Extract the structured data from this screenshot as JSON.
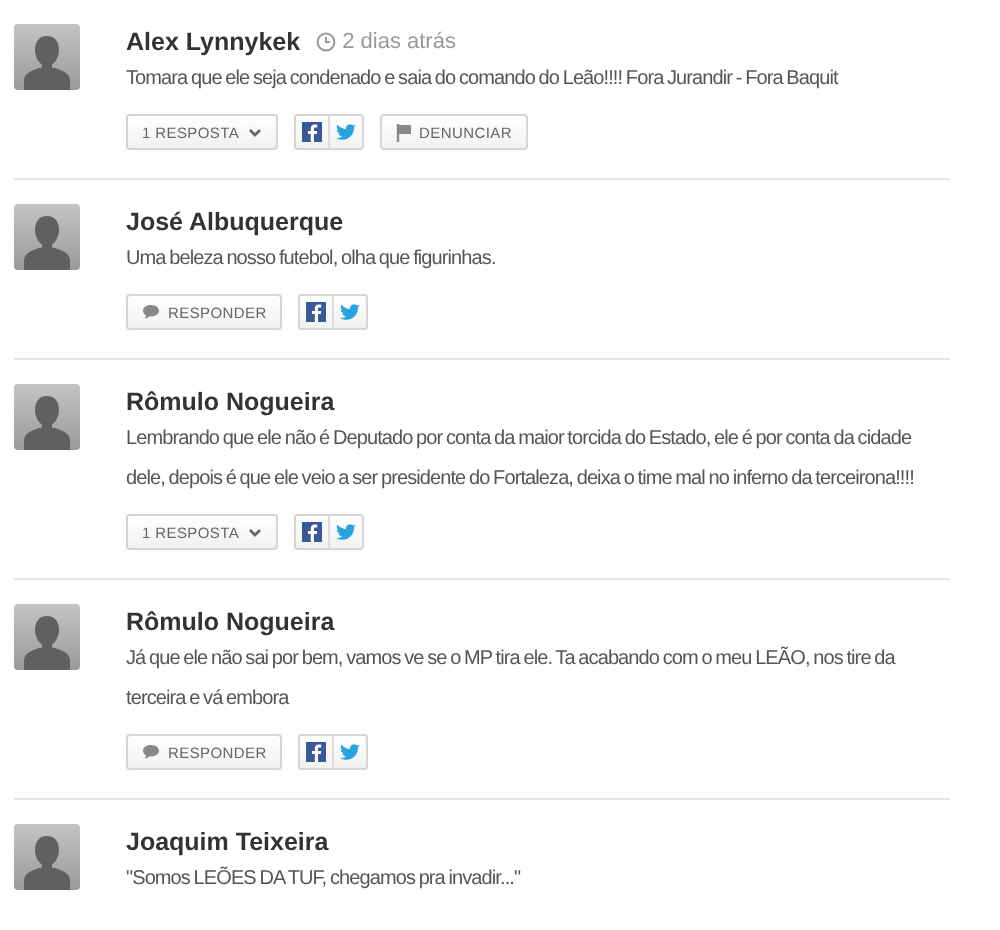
{
  "comments": [
    {
      "author": "Alex Lynnykek",
      "time": "2 dias atrás",
      "text": "Tomara que ele seja condenado e saia do comando do Leão!!!! Fora Jurandir - Fora Baquit",
      "reply": {
        "kind": "replies",
        "label": "1 RESPOSTA"
      },
      "report": "DENUNCIAR",
      "share": true
    },
    {
      "author": "José Albuquerque",
      "text": "Uma beleza nosso futebol, olha que figurinhas.",
      "reply": {
        "kind": "respond",
        "label": "RESPONDER"
      },
      "share": true
    },
    {
      "author": "Rômulo Nogueira",
      "text": "Lembrando que ele não é Deputado por conta da maior torcida do Estado, ele é por conta da cidade dele, depois é que ele veio a ser presidente do Fortaleza, deixa o time mal no inferno da terceirona!!!!",
      "reply": {
        "kind": "replies",
        "label": "1 RESPOSTA"
      },
      "share": true
    },
    {
      "author": "Rômulo Nogueira",
      "text": "Já que ele não sai por bem, vamos ve se o MP tira ele. Ta acabando com o meu LEÃO, nos tire da terceira e vá embora",
      "reply": {
        "kind": "respond",
        "label": "RESPONDER"
      },
      "share": true
    },
    {
      "author": "Joaquim Teixeira",
      "text": "\"Somos LEÕES DA TUF, chegamos pra invadir...\""
    }
  ]
}
